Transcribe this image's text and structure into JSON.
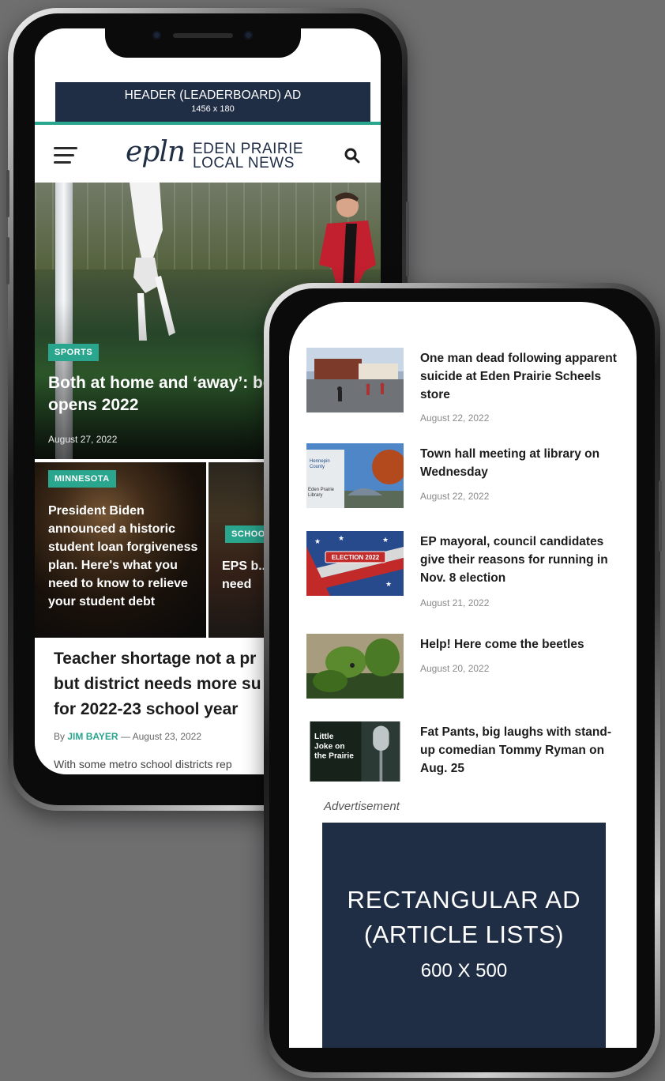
{
  "phone_left": {
    "header_ad": {
      "title": "HEADER (LEADERBOARD) AD",
      "size": "1456 x 180"
    },
    "site": {
      "logo_mark": "epln",
      "logo_line1": "EDEN PRAIRIE",
      "logo_line2": "LOCAL NEWS"
    },
    "hero": {
      "category": "SPORTS",
      "title": "Both at home and ‘away’: boys’ soccer opens 2022",
      "date": "August 27, 2022"
    },
    "cards": [
      {
        "category": "MINNESOTA",
        "title": "President Biden announced a historic student loan forgiveness plan. Here's what you need to know to relieve your student debt"
      },
      {
        "category": "SCHOOL",
        "title": "EPS b... suppli... suppor... need"
      }
    ],
    "article": {
      "title_line1": "Teacher shortage not a pr",
      "title_line2": "but district needs more su",
      "title_line3": "for 2022-23 school year",
      "byline_prefix": "By",
      "author": "JIM BAYER",
      "date": "— August 23, 2022",
      "excerpt": "With some metro school districts rep"
    }
  },
  "phone_right": {
    "articles": [
      {
        "title": "One man dead following apparent suicide at Eden Prairie Scheels store",
        "date": "August 22, 2022"
      },
      {
        "title": "Town hall meeting at library on Wednesday",
        "date": "August 22, 2022"
      },
      {
        "title": "EP mayoral, council candidates give their reasons for running in Nov. 8 election",
        "date": "August 21, 2022"
      },
      {
        "title": "Help! Here come the beetles",
        "date": "August 20, 2022"
      },
      {
        "title": "Fat Pants, big laughs with stand-up comedian Tommy Ryman on Aug. 25",
        "date": ""
      }
    ],
    "thumb_labels": {
      "election": "ELECTION 2022",
      "podcast_line1": "Little",
      "podcast_line2": "Joke on",
      "podcast_line3": "the Prairie",
      "library_line1": "Hennepin",
      "library_line2": "County",
      "library_line3": "Eden Prairie",
      "library_line4": "Library"
    },
    "advertisement_label": "Advertisement",
    "rect_ad": {
      "line1": "RECTANGULAR  AD",
      "line2": "(ARTICLE LISTS)",
      "line3": "600 X 500"
    }
  },
  "colors": {
    "accent": "#2aa58e",
    "navy": "#1f2d45",
    "background": "#6f6f70"
  },
  "icons": [
    "hamburger-menu-icon",
    "search-icon"
  ]
}
